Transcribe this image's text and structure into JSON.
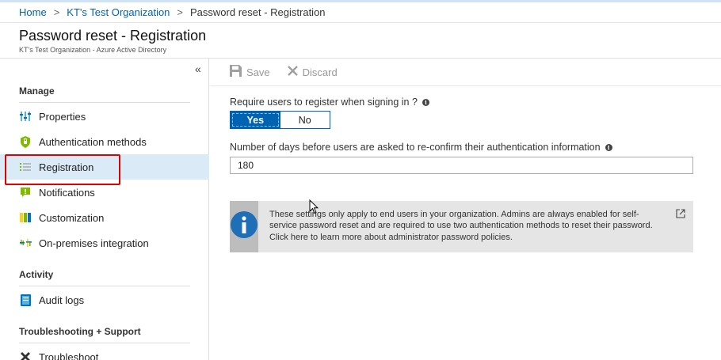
{
  "breadcrumb": {
    "items": [
      {
        "label": "Home"
      },
      {
        "label": "KT's Test Organization"
      },
      {
        "label": "Password reset - Registration"
      }
    ],
    "separator": ">"
  },
  "page": {
    "title": "Password reset - Registration",
    "subtitle": "KT's Test Organization - Azure Active Directory"
  },
  "sidebar": {
    "collapse_glyph": "«",
    "sections": [
      {
        "title": "Manage",
        "items": [
          {
            "label": "Properties",
            "icon": "properties-icon"
          },
          {
            "label": "Authentication methods",
            "icon": "shield-icon"
          },
          {
            "label": "Registration",
            "icon": "list-icon",
            "active": true
          },
          {
            "label": "Notifications",
            "icon": "notification-icon"
          },
          {
            "label": "Customization",
            "icon": "customization-icon"
          },
          {
            "label": "On-premises integration",
            "icon": "sync-icon"
          }
        ]
      },
      {
        "title": "Activity",
        "items": [
          {
            "label": "Audit logs",
            "icon": "book-icon"
          }
        ]
      },
      {
        "title": "Troubleshooting + Support",
        "items": [
          {
            "label": "Troubleshoot",
            "icon": "tools-icon"
          }
        ]
      }
    ]
  },
  "toolbar": {
    "save_label": "Save",
    "discard_label": "Discard"
  },
  "settings": {
    "require_register_label": "Require users to register when signing in ?",
    "toggle_yes": "Yes",
    "toggle_no": "No",
    "toggle_selected": "Yes",
    "days_label": "Number of days before users are asked to re-confirm their authentication information",
    "days_value": "180"
  },
  "info_box": {
    "message": "These settings only apply to end users in your organization. Admins are always enabled for self-service password reset and are required to use two authentication methods to reset their password. Click here to learn more about administrator password policies."
  },
  "colors": {
    "accent": "#0063b1",
    "active_bg": "#dbeaf7",
    "highlight": "#e00000",
    "info_bg": "#e5e5e5",
    "info_icon": "#1f6fb8"
  }
}
